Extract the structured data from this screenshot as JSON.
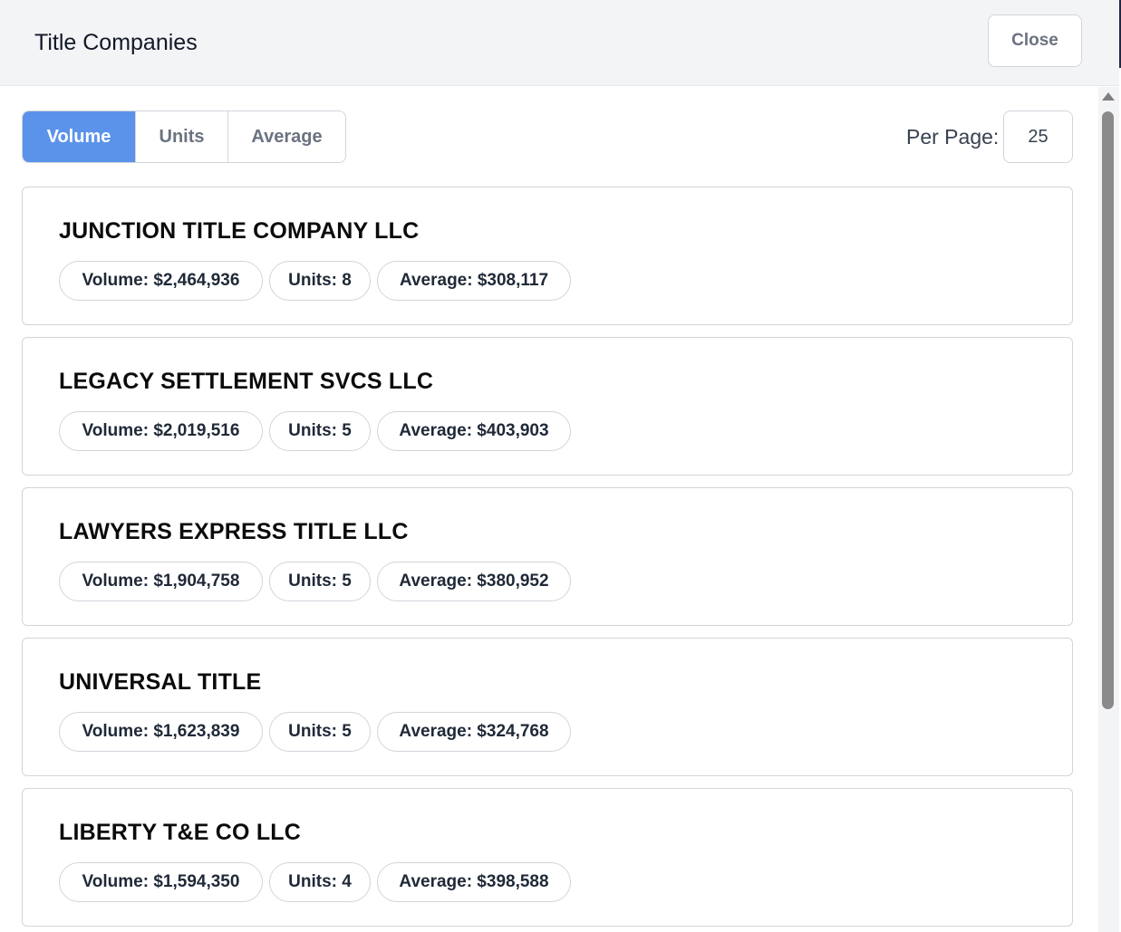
{
  "header": {
    "title": "Title Companies",
    "close_label": "Close"
  },
  "tabs": [
    {
      "label": "Volume",
      "active": true
    },
    {
      "label": "Units",
      "active": false
    },
    {
      "label": "Average",
      "active": false
    }
  ],
  "per_page": {
    "label": "Per Page:",
    "value": "25"
  },
  "companies": [
    {
      "name": "JUNCTION TITLE COMPANY LLC",
      "volume": "Volume: $2,464,936",
      "units": "Units: 8",
      "average": "Average: $308,117"
    },
    {
      "name": "LEGACY SETTLEMENT SVCS LLC",
      "volume": "Volume: $2,019,516",
      "units": "Units: 5",
      "average": "Average: $403,903"
    },
    {
      "name": "LAWYERS EXPRESS TITLE LLC",
      "volume": "Volume: $1,904,758",
      "units": "Units: 5",
      "average": "Average: $380,952"
    },
    {
      "name": "UNIVERSAL TITLE",
      "volume": "Volume: $1,623,839",
      "units": "Units: 5",
      "average": "Average: $324,768"
    },
    {
      "name": "LIBERTY T&E CO LLC",
      "volume": "Volume: $1,594,350",
      "units": "Units: 4",
      "average": "Average: $398,588"
    }
  ],
  "colors": {
    "accent": "#5b93ea",
    "header_bg": "#f3f4f6",
    "border": "#d1d5db"
  },
  "icons": {
    "scroll_up": "triangle-up"
  }
}
